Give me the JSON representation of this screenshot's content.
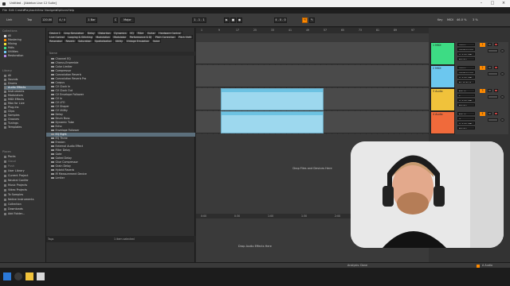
{
  "window": {
    "title": "Untitled - [Ableton Live 12 Suite]"
  },
  "menu": [
    "File",
    "Edit",
    "Create",
    "Playback",
    "View",
    "Navigate",
    "Options",
    "Help"
  ],
  "transport": {
    "link": "Link",
    "tap": "Tap",
    "tempo": "120.00",
    "signature": "4 / 4",
    "quantize": "1 Bar",
    "key": "C",
    "scale": "Major",
    "position": "1 . 1 . 1",
    "loop_len": "4 . 0 . 0",
    "key_label": "Key",
    "midi_label": "MIDI",
    "cpu": "46.0 %",
    "bpm_display": "3 %"
  },
  "nav": {
    "collections_header": "Collections",
    "collections": [
      "All",
      "Mastering",
      "Mixing",
      "Mdls",
      "Utilities",
      "Restoration"
    ],
    "library_header": "Library",
    "library": [
      "All",
      "Sounds",
      "Drums",
      "Audio Effects",
      "Instruments",
      "Modulators",
      "MIDI Effects",
      "Max for Live",
      "Plug-Ins",
      "Clips",
      "Samples",
      "Grooves",
      "Tunings",
      "Templates"
    ],
    "places_header": "Places",
    "places": [
      "Packs",
      "Cloud",
      "Push",
      "User Library",
      "Current Project",
      "Neutral Conifer",
      "Music Projects",
      "Video Projects",
      "To Samples",
      "Native Instruments",
      "Collection",
      "Downloads",
      "Add Folder..."
    ]
  },
  "browser": {
    "tags": [
      "Device  1",
      "Amp Simulation",
      "Delay",
      "Distortion",
      "Dynamics",
      "EQ",
      "Filter",
      "Guitar",
      "Hardware Control",
      "Live Control",
      "Looping & Glitching",
      "Modulation",
      "Modulator",
      "Performance & DJ",
      "Pitch Correction",
      "Pitch Shift",
      "Resonator",
      "Reverb",
      "Saturation",
      "Spatialization",
      "Utility",
      "Vintage Emulation",
      "Voice"
    ],
    "name_header": "Name",
    "items": [
      "Channel EQ",
      "Chorus-Ensemble",
      "Color Limiter",
      "Compressor",
      "Convolution Reverb",
      "Convolution Reverb Pro",
      "Corpus",
      "CV Clock In",
      "CV Clock Out",
      "CV Envelope Follower",
      "CV In",
      "CV LFO",
      "CV Shaper",
      "CV Utility",
      "Delay",
      "Drum Buss",
      "Dynamic Tube",
      "Echo",
      "Envelope Follower",
      "EQ Eight",
      "EQ Three",
      "Erosion",
      "External Audio Effect",
      "Filter Delay",
      "Gate",
      "Gated Delay",
      "Glue Compressor",
      "Grain Delay",
      "Hybrid Reverb",
      "IR Measurement Device",
      "Limiter"
    ],
    "selected_index": 19,
    "footer_tags": "Tags",
    "footer_status": "1 item selected"
  },
  "arrangement": {
    "ruler": [
      "1",
      "9",
      "17",
      "25",
      "33",
      "41",
      "49",
      "57",
      "65",
      "73",
      "81",
      "89",
      "97"
    ],
    "time_ruler": [
      "0:00",
      "0:30",
      "1:00",
      "1:30",
      "2:00",
      "2:30",
      "3:00"
    ],
    "drop_hint": "Drop Files and Devices Here"
  },
  "mixer": {
    "tracks": [
      {
        "name": "1 MIDI",
        "color": "#3ddc84",
        "input": "All Ins",
        "channel": "All Channels",
        "monitor": "In Auto Off",
        "output": "Master",
        "num": "1"
      },
      {
        "name": "2 MIDI",
        "color": "#6cc7ef",
        "input": "All Ins",
        "channel": "All Channels",
        "monitor": "In Auto Off",
        "output": "No Output",
        "num": "2"
      },
      {
        "name": "3 Audio",
        "color": "#f0c23b",
        "input": "Ext. In",
        "channel": "1",
        "monitor": "In Auto Off",
        "output": "Master",
        "num": "3"
      },
      {
        "name": "4 Audio",
        "color": "#f06a3b",
        "input": "Ext. In",
        "channel": "2",
        "monitor": "In Auto Off",
        "output": "Master",
        "num": "4"
      }
    ]
  },
  "detail": {
    "drop_hint": "Drop Audio Effects Here"
  },
  "statusbar": {
    "analysis": "Analysis: Done",
    "track_label": "A Audio"
  },
  "colors": {
    "accent": "#ff8a00",
    "selection": "#5c6f7c",
    "clip": "#9dd8ee"
  }
}
